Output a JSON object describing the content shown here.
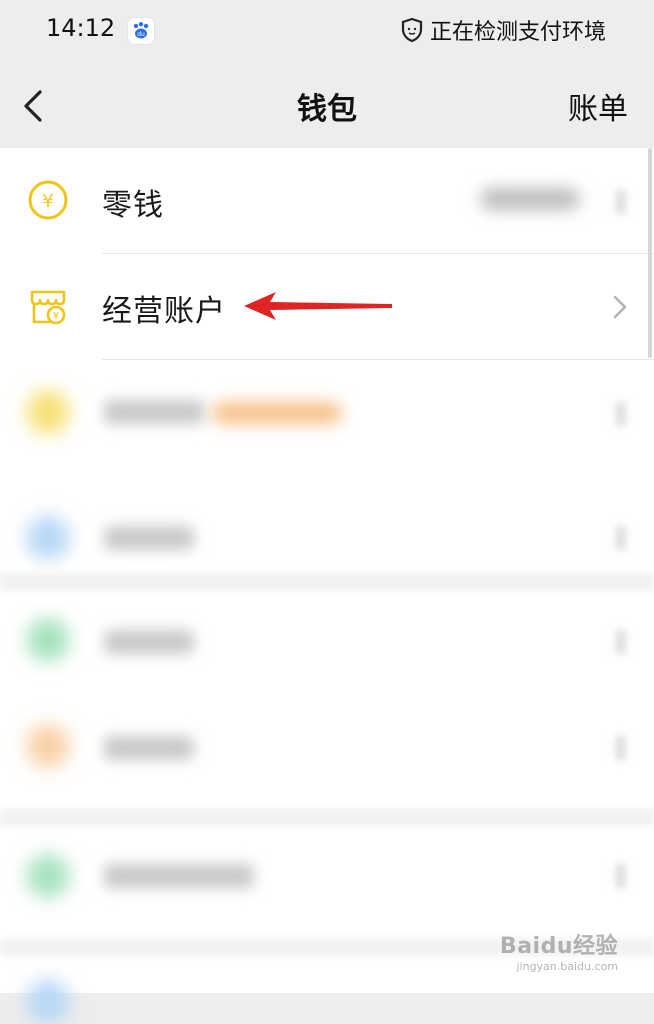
{
  "status_bar": {
    "time": "14:12",
    "right_text": "正在检测支付环境",
    "app_icon": "baidu-paw-icon",
    "security_icon": "shield-icon"
  },
  "nav": {
    "title": "钱包",
    "right_action": "账单",
    "back_icon": "chevron-left-icon"
  },
  "items": [
    {
      "label": "零钱",
      "icon": "yuan-coin-icon",
      "blurred_value": true
    },
    {
      "label": "经营账户",
      "icon": "store-account-icon",
      "highlighted_by_arrow": true
    }
  ],
  "blurred_items_count": 6,
  "annotation": {
    "type": "red-arrow",
    "points_to": "经营账户",
    "color": "#e02424"
  },
  "watermark": {
    "logo": "Baidu经验",
    "url": "jingyan.baidu.com"
  },
  "colors": {
    "accent_yellow": "#f0c419",
    "page_bg": "#ededed",
    "card_bg": "#ffffff",
    "arrow_red": "#e02424"
  }
}
